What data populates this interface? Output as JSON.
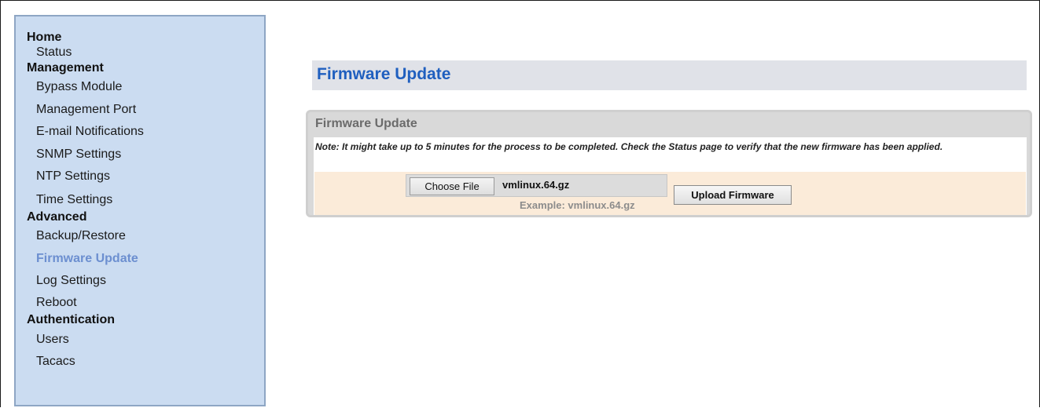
{
  "sidebar": {
    "groups": [
      {
        "title": "Home",
        "items": [
          "Status"
        ]
      },
      {
        "title": "Management",
        "items": [
          "Bypass Module",
          "Management Port",
          "E-mail Notifications",
          "SNMP Settings",
          "NTP Settings",
          "Time Settings"
        ]
      },
      {
        "title": "Advanced",
        "items": [
          "Backup/Restore",
          "Firmware Update",
          "Log Settings",
          "Reboot"
        ]
      },
      {
        "title": "Authentication",
        "items": [
          "Users",
          "Tacacs"
        ]
      }
    ],
    "active_item": "Firmware Update"
  },
  "main": {
    "page_title": "Firmware Update",
    "panel": {
      "title": "Firmware Update",
      "note": "Note: It might take up to 5 minutes for the process to be completed. Check the Status page to verify that the new firmware has been applied.",
      "file_input": {
        "button_label": "Choose File",
        "selected_file": "vmlinux.64.gz",
        "example": "Example: vmlinux.64.gz"
      },
      "upload_button": "Upload Firmware"
    }
  },
  "colors": {
    "sidebar_bg": "#cbdcf1",
    "active_link": "#6c8fd0",
    "title_blue": "#1f5fbf",
    "form_row_bg": "#fbebd9"
  }
}
